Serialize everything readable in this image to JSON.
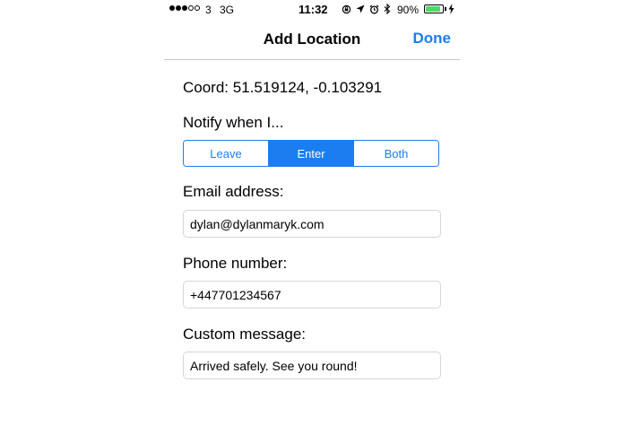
{
  "status_bar": {
    "carrier": "3",
    "network": "3G",
    "time": "11:32",
    "battery_percent": "90%",
    "battery_level": 0.9,
    "icons": [
      "rotation-lock-icon",
      "location-arrow-icon",
      "alarm-icon",
      "bluetooth-icon",
      "battery-icon",
      "charging-icon"
    ]
  },
  "nav": {
    "title": "Add Location",
    "done_label": "Done"
  },
  "coord": {
    "text": "Coord: 51.519124, -0.103291"
  },
  "notify": {
    "label": "Notify when I...",
    "options": [
      "Leave",
      "Enter",
      "Both"
    ],
    "selected": "Enter"
  },
  "email": {
    "label": "Email address:",
    "value": "dylan@dylanmaryk.com"
  },
  "phone": {
    "label": "Phone number:",
    "value": "+447701234567"
  },
  "message": {
    "label": "Custom message:",
    "value": "Arrived safely. See you round!"
  },
  "colors": {
    "accent": "#1a7ef0",
    "battery": "#4cd964"
  }
}
